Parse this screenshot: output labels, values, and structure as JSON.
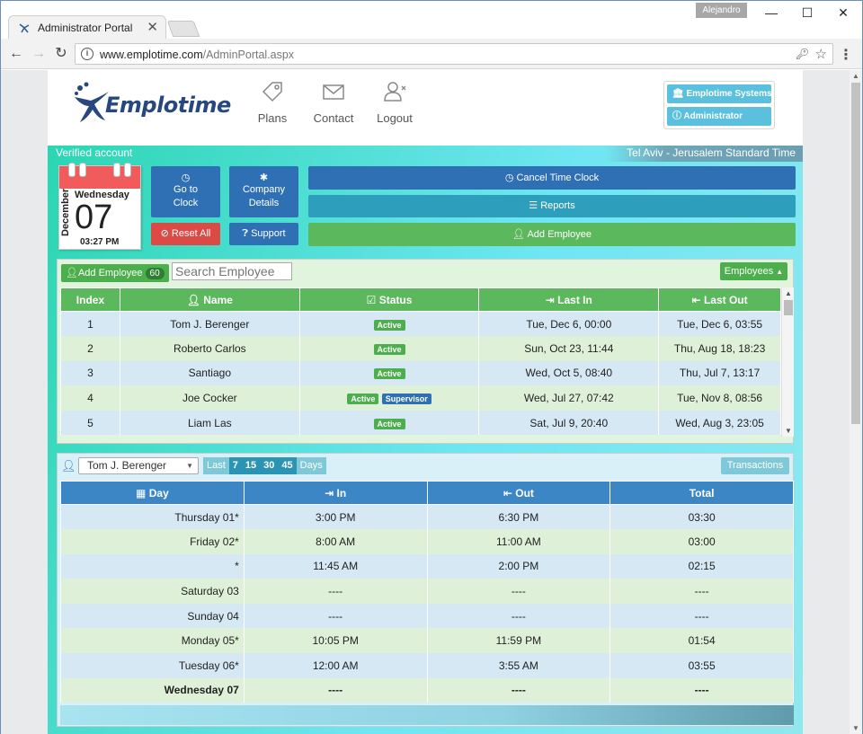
{
  "browser": {
    "tab_title": "Administrator Portal",
    "tab_close": "✕",
    "user": "Alejandro",
    "url_host": "www.emplotime.com",
    "url_path": "/AdminPortal.aspx"
  },
  "header": {
    "logo_text": "Emplotime",
    "nav": [
      {
        "label": "Plans",
        "icon": "tag-icon"
      },
      {
        "label": "Contact",
        "icon": "envelope-icon"
      },
      {
        "label": "Logout",
        "icon": "user-remove-icon"
      }
    ],
    "account_buttons": [
      "Emplotime Systems",
      "Administrator"
    ]
  },
  "status": {
    "verified": "Verified account",
    "timezone": "Tel Aviv - Jerusalem Standard Time"
  },
  "calendar": {
    "month": "December",
    "weekday": "Wednesday",
    "day": "07",
    "time": "03:27 PM"
  },
  "actions": {
    "go_to_clock": [
      "Go to",
      "Clock"
    ],
    "company_details": [
      "Company",
      "Details"
    ],
    "reset_all": "Reset All",
    "support": "Support",
    "cancel_time_clock": "Cancel Time Clock",
    "reports": "Reports",
    "add_employee": "Add Employee"
  },
  "employees": {
    "add_label": "Add Employee",
    "count": "60",
    "search_placeholder": "Search Employee",
    "dropdown": "Employees",
    "columns": [
      "Index",
      "Name",
      "Status",
      "Last In",
      "Last Out"
    ],
    "rows": [
      {
        "index": "1",
        "name": "Tom J. Berenger",
        "status": [
          "Active"
        ],
        "last_in": "Tue, Dec 6, 00:00",
        "last_out": "Tue, Dec 6, 03:55"
      },
      {
        "index": "2",
        "name": "Roberto Carlos",
        "status": [
          "Active"
        ],
        "last_in": "Sun, Oct 23, 11:44",
        "last_out": "Thu, Aug 18, 18:23"
      },
      {
        "index": "3",
        "name": "Santiago",
        "status": [
          "Active"
        ],
        "last_in": "Wed, Oct 5, 08:40",
        "last_out": "Thu, Jul 7, 13:17"
      },
      {
        "index": "4",
        "name": "Joe Cocker",
        "status": [
          "Active",
          "Supervisor"
        ],
        "last_in": "Wed, Jul 27, 07:42",
        "last_out": "Tue, Nov 8, 08:56"
      },
      {
        "index": "5",
        "name": "Liam Las",
        "status": [
          "Active"
        ],
        "last_in": "Sat, Jul 9, 20:40",
        "last_out": "Wed, Aug 3, 23:05"
      }
    ]
  },
  "timesheet": {
    "selected_employee": "Tom J. Berenger",
    "days_label_last": "Last",
    "days_options": [
      "7",
      "15",
      "30",
      "45"
    ],
    "days_label": "Days",
    "transactions": "Transactions",
    "columns": [
      "Day",
      "In",
      "Out",
      "Total"
    ],
    "rows": [
      {
        "day": "Thursday 01*",
        "in": "3:00 PM",
        "out": "6:30 PM",
        "total": "03:30"
      },
      {
        "day": "Friday 02*",
        "in": "8:00 AM",
        "out": "11:00 AM",
        "total": "03:00"
      },
      {
        "day": "*",
        "in": "11:45 AM",
        "out": "2:00 PM",
        "total": "02:15"
      },
      {
        "day": "Saturday 03",
        "in": "----",
        "out": "----",
        "total": "----"
      },
      {
        "day": "Sunday 04",
        "in": "----",
        "out": "----",
        "total": "----"
      },
      {
        "day": "Monday 05*",
        "in": "10:05 PM",
        "out": "11:59 PM",
        "total": "01:54"
      },
      {
        "day": "Tuesday 06*",
        "in": "12:00 AM",
        "out": "3:55 AM",
        "total": "03:55"
      },
      {
        "day": "Wednesday 07",
        "in": "----",
        "out": "----",
        "total": "----",
        "bold": true
      }
    ]
  },
  "colors": {
    "brand": "#27477f",
    "accent_green": "#5cb85c",
    "accent_blue": "#2f70b4",
    "accent_red": "#dc4a45",
    "accent_teal": "#2e9ebd"
  }
}
